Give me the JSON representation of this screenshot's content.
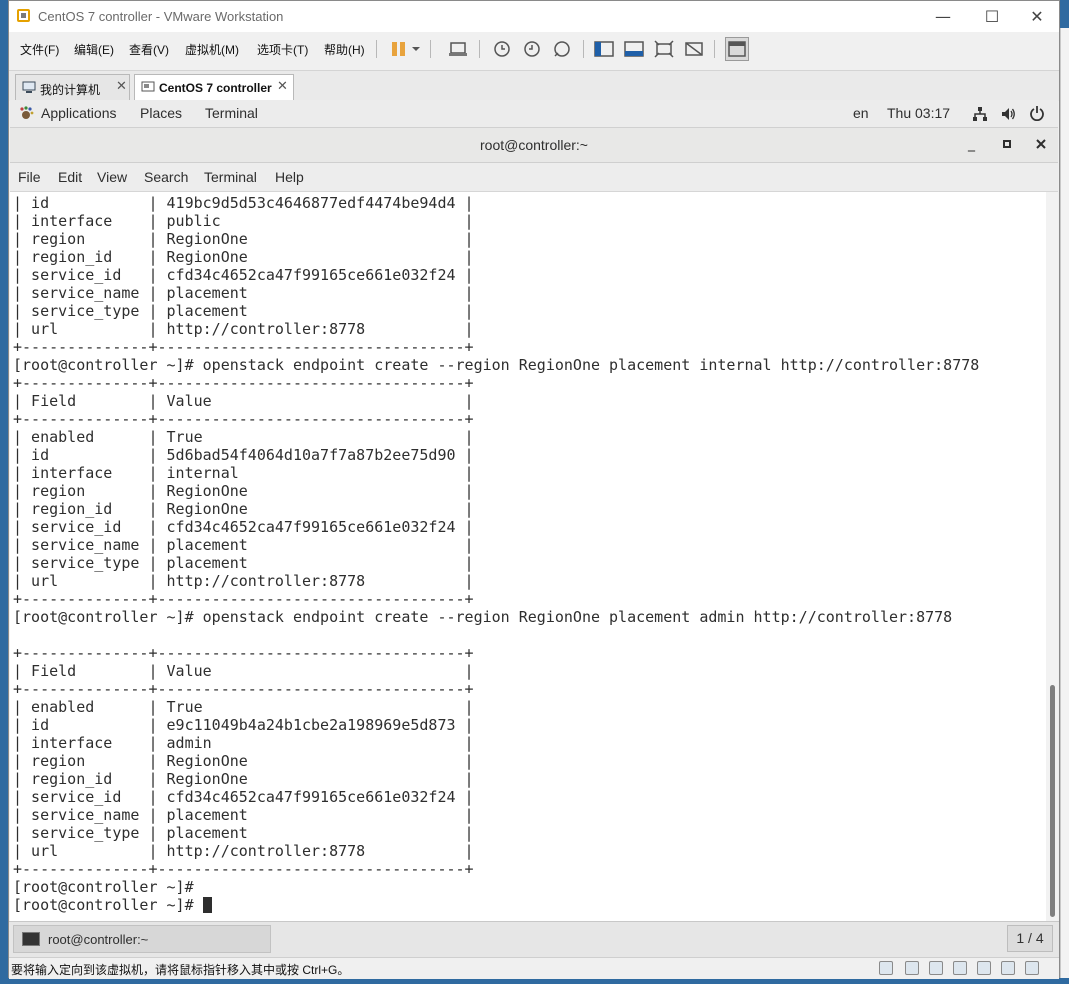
{
  "window": {
    "title": "CentOS 7 controller - VMware Workstation",
    "minimize": "—",
    "maximize": "☐",
    "close": "✕"
  },
  "menubar": {
    "items": [
      "文件(F)",
      "编辑(E)",
      "查看(V)",
      "虚拟机(M)",
      "选项卡(T)",
      "帮助(H)"
    ]
  },
  "tabs": [
    {
      "label": "我的计算机",
      "close": "✕"
    },
    {
      "label": "CentOS 7 controller",
      "close": "✕"
    }
  ],
  "gnome_bar": {
    "applications": "Applications",
    "places": "Places",
    "terminal": "Terminal",
    "lang": "en",
    "clock": "Thu 03:17"
  },
  "terminal": {
    "title": "root@controller:~",
    "menu": [
      "File",
      "Edit",
      "View",
      "Search",
      "Terminal",
      "Help"
    ],
    "lines": [
      "| id           | 419bc9d5d53c4646877edf4474be94d4 |",
      "| interface    | public                           |",
      "| region       | RegionOne                        |",
      "| region_id    | RegionOne                        |",
      "| service_id   | cfd34c4652ca47f99165ce661e032f24 |",
      "| service_name | placement                        |",
      "| service_type | placement                        |",
      "| url          | http://controller:8778           |",
      "+--------------+----------------------------------+",
      "[root@controller ~]# openstack endpoint create --region RegionOne placement internal http://controller:8778",
      "+--------------+----------------------------------+",
      "| Field        | Value                            |",
      "+--------------+----------------------------------+",
      "| enabled      | True                             |",
      "| id           | 5d6bad54f4064d10a7f7a87b2ee75d90 |",
      "| interface    | internal                         |",
      "| region       | RegionOne                        |",
      "| region_id    | RegionOne                        |",
      "| service_id   | cfd34c4652ca47f99165ce661e032f24 |",
      "| service_name | placement                        |",
      "| service_type | placement                        |",
      "| url          | http://controller:8778           |",
      "+--------------+----------------------------------+",
      "[root@controller ~]# openstack endpoint create --region RegionOne placement admin http://controller:8778",
      "",
      "+--------------+----------------------------------+",
      "| Field        | Value                            |",
      "+--------------+----------------------------------+",
      "| enabled      | True                             |",
      "| id           | e9c11049b4a24b1cbe2a198969e5d873 |",
      "| interface    | admin                            |",
      "| region       | RegionOne                        |",
      "| region_id    | RegionOne                        |",
      "| service_id   | cfd34c4652ca47f99165ce661e032f24 |",
      "| service_name | placement                        |",
      "| service_type | placement                        |",
      "| url          | http://controller:8778           |",
      "+--------------+----------------------------------+",
      "[root@controller ~]#",
      "[root@controller ~]# "
    ]
  },
  "taskbar": {
    "task_label": "root@controller:~",
    "pager": "1 / 4"
  },
  "statusbar": {
    "text": "要将输入定向到该虚拟机，请将鼠标指针移入其中或按 Ctrl+G。"
  },
  "colors": {
    "terminal_bg": "#ffffff",
    "terminal_fg": "#2e2e2e",
    "pause_icon": "#e8a33d"
  }
}
